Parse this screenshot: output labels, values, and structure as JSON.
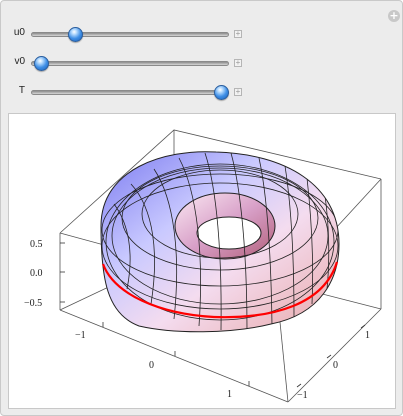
{
  "controls": {
    "u0": {
      "label": "u0",
      "fraction": 0.22
    },
    "v0": {
      "label": "v0",
      "fraction": 0.05
    },
    "T": {
      "label": "T",
      "fraction": 0.96
    }
  },
  "close_glyph": "+",
  "plus_glyph": "+",
  "plot": {
    "z_ticks": [
      "0.5",
      "0.0",
      "−0.5"
    ],
    "front_ticks": [
      "−1",
      "0",
      "1"
    ],
    "right_ticks": [
      "1",
      "0",
      "−1"
    ],
    "curve_color": "#ff0000"
  }
}
